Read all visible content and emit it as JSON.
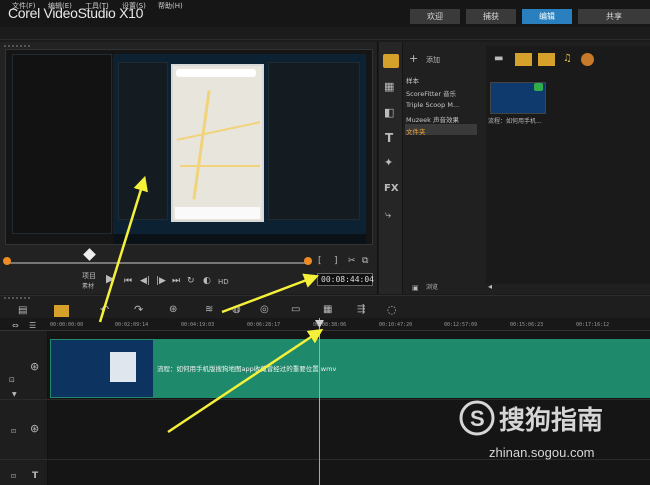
{
  "app": {
    "title": "Corel VideoStudio X10"
  },
  "nav_tabs": [
    {
      "label": "欢迎"
    },
    {
      "label": "捕获"
    },
    {
      "label": "编辑"
    },
    {
      "label": "共享"
    }
  ],
  "menu": [
    {
      "label": "文件(F)"
    },
    {
      "label": "编辑(E)"
    },
    {
      "label": "工具(T)"
    },
    {
      "label": "设置(S)"
    },
    {
      "label": "帮助(H)"
    }
  ],
  "player": {
    "mode_project": "项目",
    "mode_clip": "素材",
    "hd": "HD",
    "timecode": "00:08:44:04"
  },
  "library": {
    "add_label": "添加",
    "tree": [
      {
        "label": "样本"
      },
      {
        "label": "ScoreFitter 音乐"
      },
      {
        "label": "Triple Scoop M..."
      },
      {
        "label": "Muzeek 声音效果"
      },
      {
        "label": "文件夹"
      }
    ],
    "thumb_label": "流程：如何用手机...",
    "browse_label": "浏览"
  },
  "timeline": {
    "ruler_ticks": [
      "00:00:00:00",
      "00:02:09:14",
      "00:04:19:03",
      "00:06:28:17",
      "00:08:38:06",
      "00:10:47:20",
      "00:12:57:09",
      "00:15:06:23",
      "00:17:16:12"
    ],
    "clip_label": "流程：如何用手机版搜狗地图app收藏曾经过的重要位置.wmv"
  },
  "watermark": {
    "brand": "搜狗指南",
    "url": "zhinan.sogou.com"
  },
  "colors": {
    "accent": "#2a7fbe",
    "clip": "#1f8a6b",
    "scrub_handle": "#f08a24",
    "arrow": "#f5f03a"
  }
}
